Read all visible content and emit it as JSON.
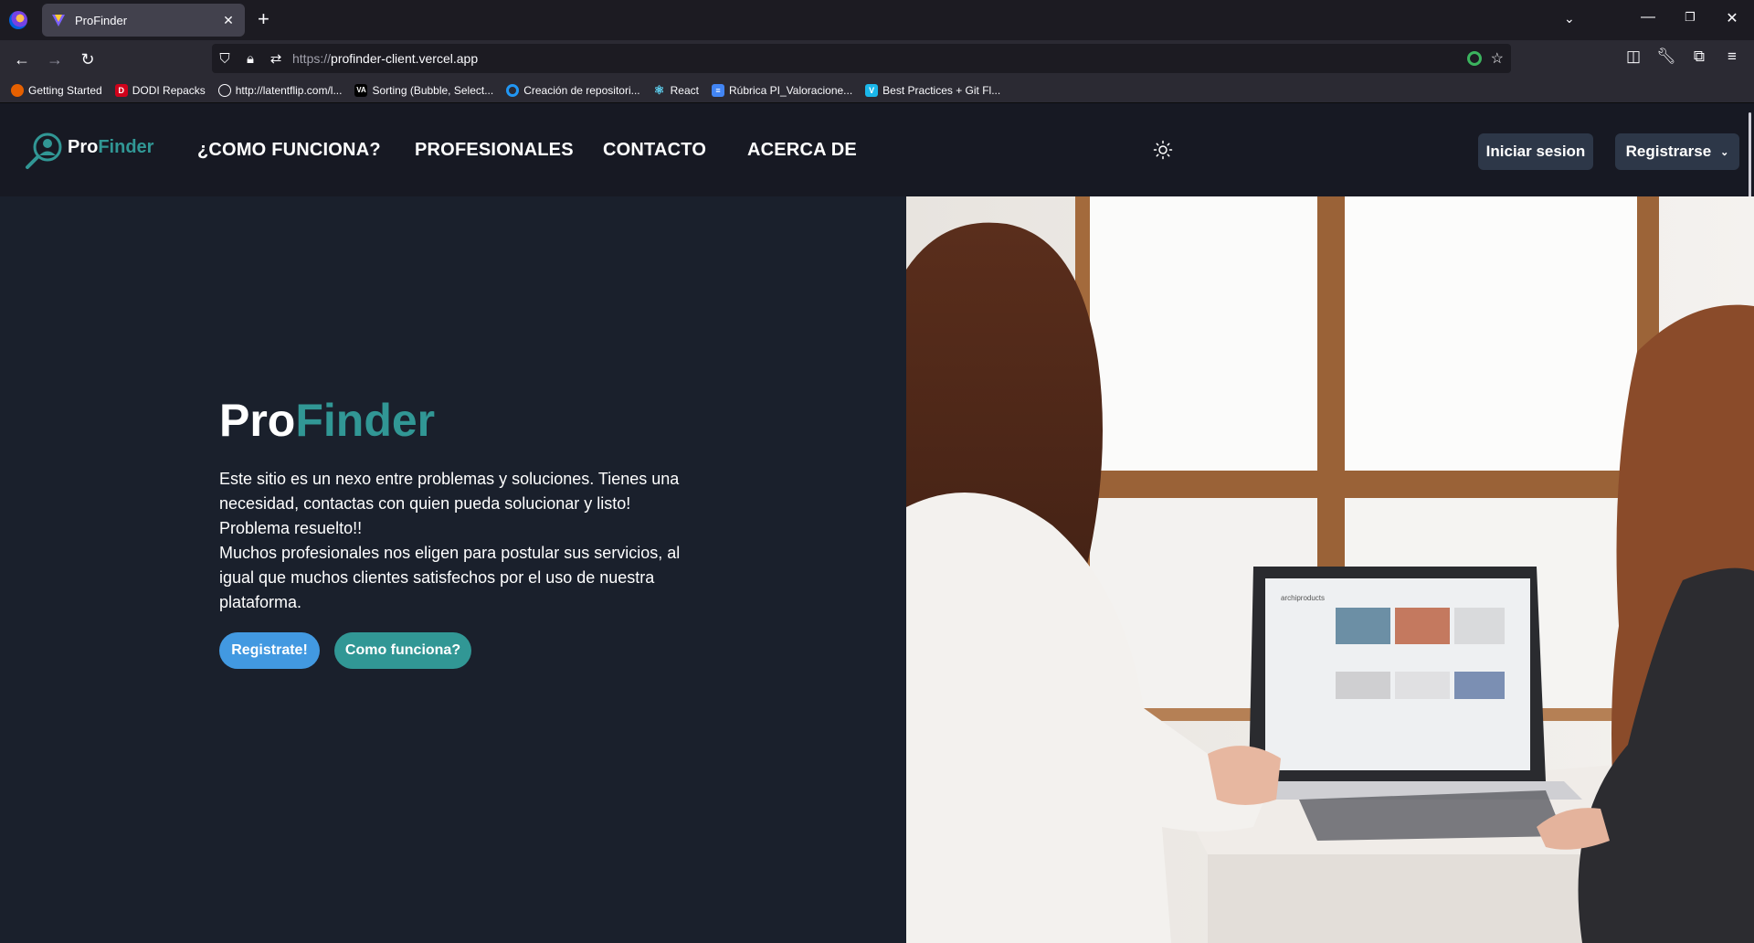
{
  "browser": {
    "tab": {
      "title": "ProFinder"
    },
    "url": {
      "protocol": "https://",
      "host": "profinder-client.vercel.app"
    },
    "bookmarks": [
      {
        "label": "Getting Started",
        "icon": "firefox-icon",
        "color": "#e66000"
      },
      {
        "label": "DODI Repacks",
        "icon": "dodi-icon",
        "color": "#d0021b"
      },
      {
        "label": "http://latentflip.com/l...",
        "icon": "globe-icon",
        "color": "#2b2a33"
      },
      {
        "label": "Sorting (Bubble, Select...",
        "icon": "visualgo-icon",
        "color": "#000000"
      },
      {
        "label": "Creación de repositori...",
        "icon": "circle-icon",
        "color": "#2196f3"
      },
      {
        "label": "React",
        "icon": "react-icon",
        "color": "#1c1b22"
      },
      {
        "label": "Rúbrica PI_Valoracione...",
        "icon": "docs-icon",
        "color": "#4285f4"
      },
      {
        "label": "Best Practices + Git Fl...",
        "icon": "vimeo-icon",
        "color": "#1ab7ea"
      }
    ]
  },
  "site": {
    "brand": {
      "part1": "Pro",
      "part2": "Finder"
    },
    "nav": [
      {
        "label": "¿COMO FUNCIONA?"
      },
      {
        "label": "PROFESIONALES"
      },
      {
        "label": "CONTACTO"
      },
      {
        "label": "ACERCA DE"
      }
    ],
    "login_label": "Iniciar sesion",
    "register_label": "Registrarse",
    "hero": {
      "title_part1": "Pro",
      "title_part2": "Finder",
      "paragraph1": "Este sitio es un nexo entre problemas y soluciones. Tienes una necesidad, contactas con quien pueda solucionar y listo! Problema resuelto!!",
      "paragraph2": "Muchos profesionales nos eligen para postular sus servicios, al igual que muchos clientes satisfechos por el uso de nuestra plataforma.",
      "cta_primary": "Registrate!",
      "cta_secondary": "Como funciona?"
    },
    "laptop_screen_text": "archiproducts"
  },
  "colors": {
    "accent_teal": "#319795",
    "accent_blue": "#4299e1",
    "header_bg": "#171923",
    "page_bg": "#1a202c",
    "button_bg": "#2d3748"
  }
}
